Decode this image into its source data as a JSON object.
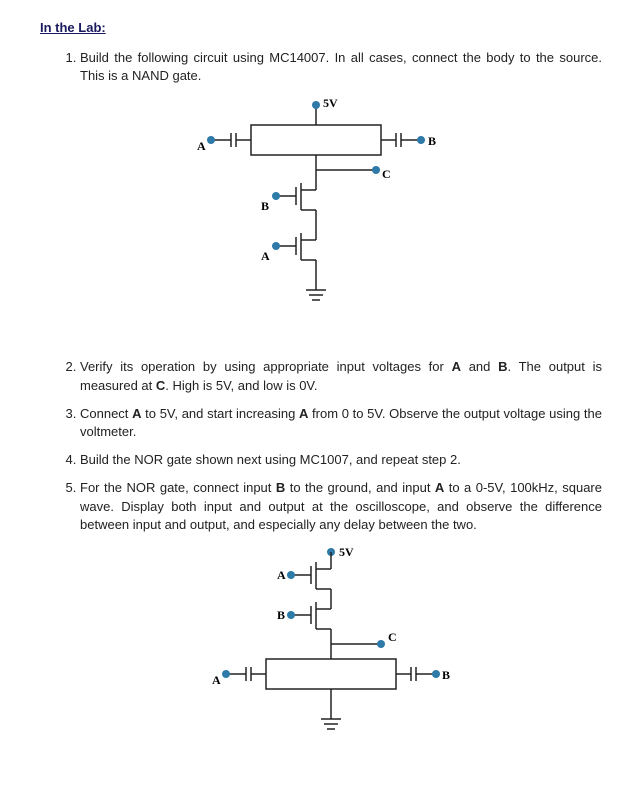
{
  "section_title": "In the Lab:",
  "steps": {
    "s1": "Build the following circuit using MC14007. In all cases, connect the body to the source. This is a NAND gate.",
    "s2_a": "Verify its operation by using appropriate input voltages for ",
    "s2_b": "A",
    "s2_c": " and ",
    "s2_d": "B",
    "s2_e": ". The output is measured at ",
    "s2_f": "C",
    "s2_g": ". High is 5V, and low is 0V.",
    "s3_a": "Connect ",
    "s3_b": "A",
    "s3_c": " to 5V, and start increasing ",
    "s3_d": "A",
    "s3_e": " from 0 to 5V. Observe the output voltage using the voltmeter.",
    "s4": "Build the NOR gate shown next using MC1007, and repeat step 2.",
    "s5_a": "For the NOR gate, connect input ",
    "s5_b": "B",
    "s5_c": " to the ground, and input ",
    "s5_d": "A",
    "s5_e": " to a 0-5V, 100kHz, square wave. Display both input and output at the oscilloscope, and observe the difference between input and output, and especially  any delay between the two."
  },
  "diagram1": {
    "vcc": "5V",
    "A_top": "A",
    "B_right": "B",
    "C": "C",
    "B_mid": "B",
    "A_bot": "A"
  },
  "diagram2": {
    "vcc": "5V",
    "A_top": "A",
    "B_top": "B",
    "C": "C",
    "B_right": "B",
    "A_bot": "A"
  }
}
